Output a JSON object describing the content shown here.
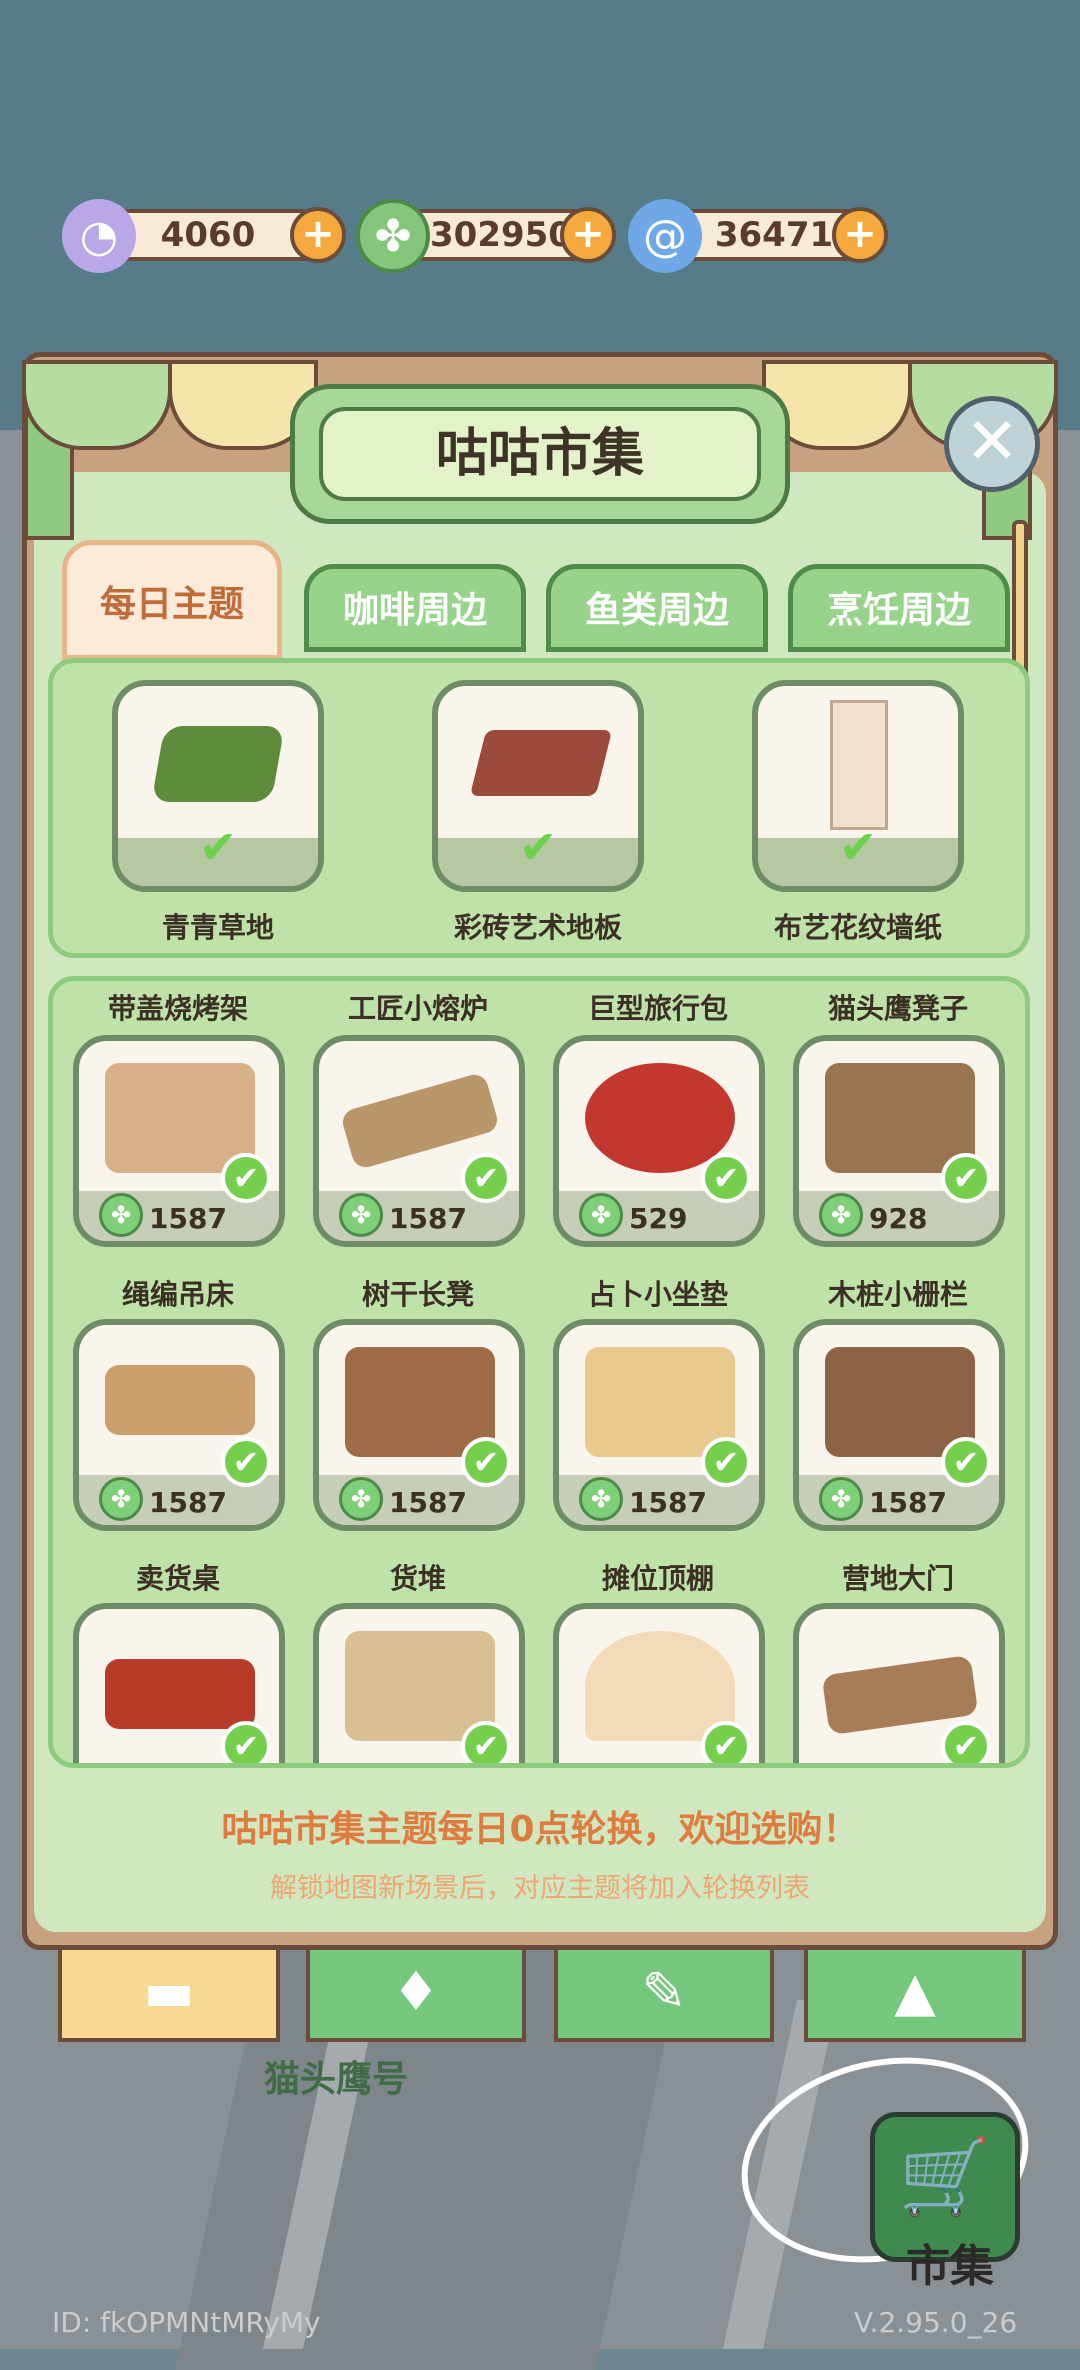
{
  "currency": [
    {
      "name": "shell",
      "icon": "shell-icon",
      "value": "4060",
      "plus": "+"
    },
    {
      "name": "clover",
      "icon": "clover-coin-icon",
      "value": "302950",
      "plus": "+"
    },
    {
      "name": "swirl",
      "icon": "swirl-icon",
      "value": "36471",
      "plus": "+"
    }
  ],
  "panel": {
    "title": "咕咕市集",
    "close": "✕"
  },
  "tabs": [
    "每日主题",
    "咖啡周边",
    "鱼类周边",
    "烹饪周边"
  ],
  "theme_items": [
    {
      "name": "青青草地",
      "check": "✔"
    },
    {
      "name": "彩砖艺术地板",
      "check": "✔"
    },
    {
      "name": "布艺花纹墙纸",
      "check": "✔"
    }
  ],
  "items": [
    {
      "name": "带盖烧烤架",
      "price": "1587"
    },
    {
      "name": "工匠小熔炉",
      "price": "1587"
    },
    {
      "name": "巨型旅行包",
      "price": "529"
    },
    {
      "name": "猫头鹰凳子",
      "price": "928"
    },
    {
      "name": "绳编吊床",
      "price": "1587"
    },
    {
      "name": "树干长凳",
      "price": "1587"
    },
    {
      "name": "占卜小坐垫",
      "price": "1587"
    },
    {
      "name": "木桩小栅栏",
      "price": "1587"
    },
    {
      "name": "卖货桌",
      "price": ""
    },
    {
      "name": "货堆",
      "price": ""
    },
    {
      "name": "摊位顶棚",
      "price": ""
    },
    {
      "name": "营地大门",
      "price": ""
    }
  ],
  "notice": "咕咕市集主题每日0点轮换，欢迎选购！",
  "subnotice": "解锁地图新场景后，对应主题将加入轮换列表",
  "ship_label": "猫头鹰号",
  "market": {
    "label": "市集",
    "icon": "cart-icon"
  },
  "footer": {
    "id": "ID:  fkOPMNtMRyMy",
    "version": "V.2.95.0_26"
  }
}
